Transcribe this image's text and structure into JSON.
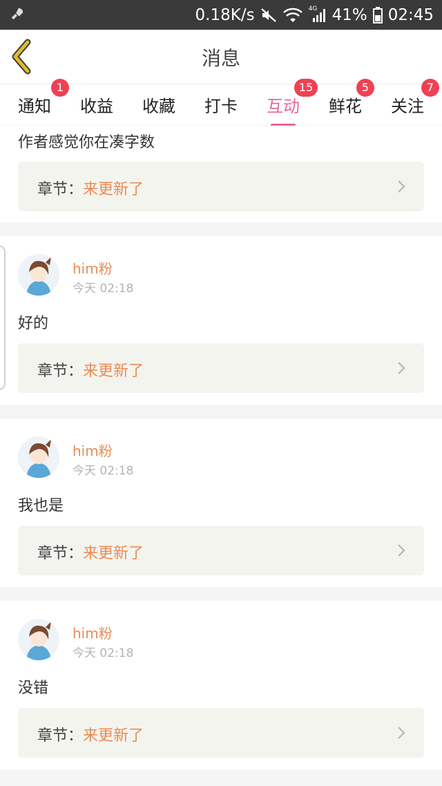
{
  "status_bar": {
    "app_icon": "rocket-icon",
    "speed": "0.18K/s",
    "mute_icon": "mute-icon",
    "wifi_icon": "wifi-icon",
    "signal_icon": "signal-4g-icon",
    "network_label": "4G",
    "battery_percent": "41%",
    "battery_icon": "battery-icon",
    "time": "02:45"
  },
  "header": {
    "back_icon": "chevron-left-icon",
    "title": "消息"
  },
  "tabs": [
    {
      "label": "通知",
      "badge": "1"
    },
    {
      "label": "收益",
      "badge": ""
    },
    {
      "label": "收藏",
      "badge": ""
    },
    {
      "label": "打卡",
      "badge": ""
    },
    {
      "label": "互动",
      "badge": "15",
      "active": true
    },
    {
      "label": "鲜花",
      "badge": "5"
    },
    {
      "label": "关注",
      "badge": "7"
    }
  ],
  "messages": [
    {
      "text": "作者感觉你在凑字数",
      "chapter_label": "章节：",
      "chapter_value": "来更新了"
    },
    {
      "user": "him粉",
      "time": "今天 02:18",
      "text": "好的",
      "chapter_label": "章节：",
      "chapter_value": "来更新了"
    },
    {
      "user": "him粉",
      "time": "今天 02:18",
      "text": "我也是",
      "chapter_label": "章节：",
      "chapter_value": "来更新了"
    },
    {
      "user": "him粉",
      "time": "今天 02:18",
      "text": "没错",
      "chapter_label": "章节：",
      "chapter_value": "来更新了"
    }
  ],
  "colors": {
    "accent": "#e5679d",
    "username": "#e88c56",
    "badge": "#f04154",
    "back_icon": "#e0bb2a"
  }
}
